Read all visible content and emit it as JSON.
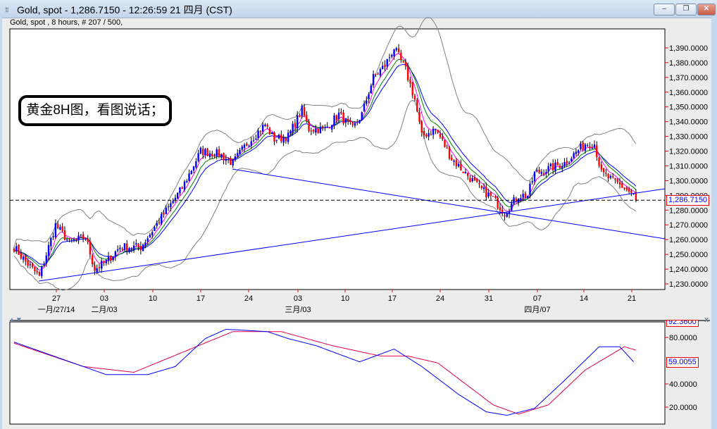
{
  "window": {
    "title": "Gold, spot - 1,286.7150 - 12:26:59  21 四月 (CST)",
    "minimize": "–",
    "restore": "❐",
    "close": "✕"
  },
  "chart_header": "Gold, spot , 8 hours, # 207 / 500,",
  "annotation": "黄金8H图，看图说话；",
  "current_price_label": "1,286.7150",
  "indicator_value_label": "59.0055",
  "indicator_top_label": "92.3600",
  "pane_close": "x",
  "pane_arrows": "▲▼",
  "colors": {
    "up": "#0000ff",
    "down": "#ff0000",
    "ma1": "#0000ff",
    "ma2": "#008000",
    "ma3": "#ff00ff",
    "bands": "#808080",
    "trend": "#0000ff",
    "ind_fast": "#0000ff",
    "ind_slow": "#e0004a"
  },
  "chart_data": [
    {
      "type": "candlestick",
      "title": "Gold, spot, 8 hours",
      "ylim": [
        1225,
        1395
      ],
      "y_ticks": [
        "1,390.0000",
        "1,380.0000",
        "1,370.0000",
        "1,360.0000",
        "1,350.0000",
        "1,340.0000",
        "1,330.0000",
        "1,320.0000",
        "1,310.0000",
        "1,300.0000",
        "1,290.0000",
        "1,280.0000",
        "1,270.0000",
        "1,260.0000",
        "1,250.0000",
        "1,240.0000",
        "1,230.0000"
      ],
      "x_ticks": [
        "27",
        "03",
        "10",
        "17",
        "24",
        "03",
        "10",
        "17",
        "24",
        "31",
        "07",
        "14",
        "21"
      ],
      "x_month_labels": [
        "一月/27/14",
        "二月/03",
        "三月/03",
        "四月/07"
      ],
      "bars": 271,
      "close_anchors": [
        [
          0,
          1255
        ],
        [
          5,
          1245
        ],
        [
          11,
          1235
        ],
        [
          18,
          1270
        ],
        [
          24,
          1258
        ],
        [
          31,
          1262
        ],
        [
          35,
          1240
        ],
        [
          40,
          1245
        ],
        [
          46,
          1255
        ],
        [
          55,
          1255
        ],
        [
          64,
          1275
        ],
        [
          73,
          1295
        ],
        [
          81,
          1320
        ],
        [
          89,
          1318
        ],
        [
          95,
          1312
        ],
        [
          101,
          1325
        ],
        [
          109,
          1338
        ],
        [
          113,
          1328
        ],
        [
          119,
          1330
        ],
        [
          125,
          1348
        ],
        [
          128,
          1335
        ],
        [
          135,
          1335
        ],
        [
          141,
          1345
        ],
        [
          147,
          1335
        ],
        [
          151,
          1345
        ],
        [
          156,
          1370
        ],
        [
          161,
          1378
        ],
        [
          165,
          1390
        ],
        [
          170,
          1375
        ],
        [
          174,
          1355
        ],
        [
          177,
          1330
        ],
        [
          183,
          1335
        ],
        [
          190,
          1315
        ],
        [
          196,
          1305
        ],
        [
          202,
          1295
        ],
        [
          208,
          1288
        ],
        [
          213,
          1278
        ],
        [
          219,
          1290
        ],
        [
          223,
          1290
        ],
        [
          226,
          1305
        ],
        [
          232,
          1308
        ],
        [
          239,
          1312
        ],
        [
          248,
          1325
        ],
        [
          252,
          1325
        ],
        [
          255,
          1305
        ],
        [
          260,
          1300
        ],
        [
          265,
          1295
        ],
        [
          269,
          1290
        ],
        [
          270,
          1286.715
        ]
      ],
      "last_price": 1286.715
    },
    {
      "type": "line",
      "y_ticks": [
        "80.0000",
        "40.0000",
        "20.0000"
      ],
      "ylim": [
        7,
        93
      ],
      "series": [
        {
          "name": "fast",
          "anchors": [
            [
              0,
              76
            ],
            [
              40,
              48
            ],
            [
              58,
              48
            ],
            [
              70,
              55
            ],
            [
              83,
              79
            ],
            [
              92,
              87
            ],
            [
              110,
              85
            ],
            [
              119,
              79
            ],
            [
              131,
              73
            ],
            [
              150,
              59
            ],
            [
              165,
              70
            ],
            [
              177,
              55
            ],
            [
              193,
              31
            ],
            [
              205,
              16
            ],
            [
              214,
              13
            ],
            [
              226,
              19
            ],
            [
              239,
              43
            ],
            [
              254,
              72
            ],
            [
              263,
              72
            ],
            [
              269,
              59
            ]
          ]
        },
        {
          "name": "slow",
          "anchors": [
            [
              0,
              75
            ],
            [
              30,
              55
            ],
            [
              52,
              50
            ],
            [
              95,
              85
            ],
            [
              116,
              85
            ],
            [
              138,
              73
            ],
            [
              159,
              64
            ],
            [
              171,
              64
            ],
            [
              184,
              58
            ],
            [
              208,
              22
            ],
            [
              219,
              14
            ],
            [
              232,
              22
            ],
            [
              248,
              52
            ],
            [
              265,
              72
            ],
            [
              270,
              69
            ]
          ]
        }
      ]
    }
  ]
}
